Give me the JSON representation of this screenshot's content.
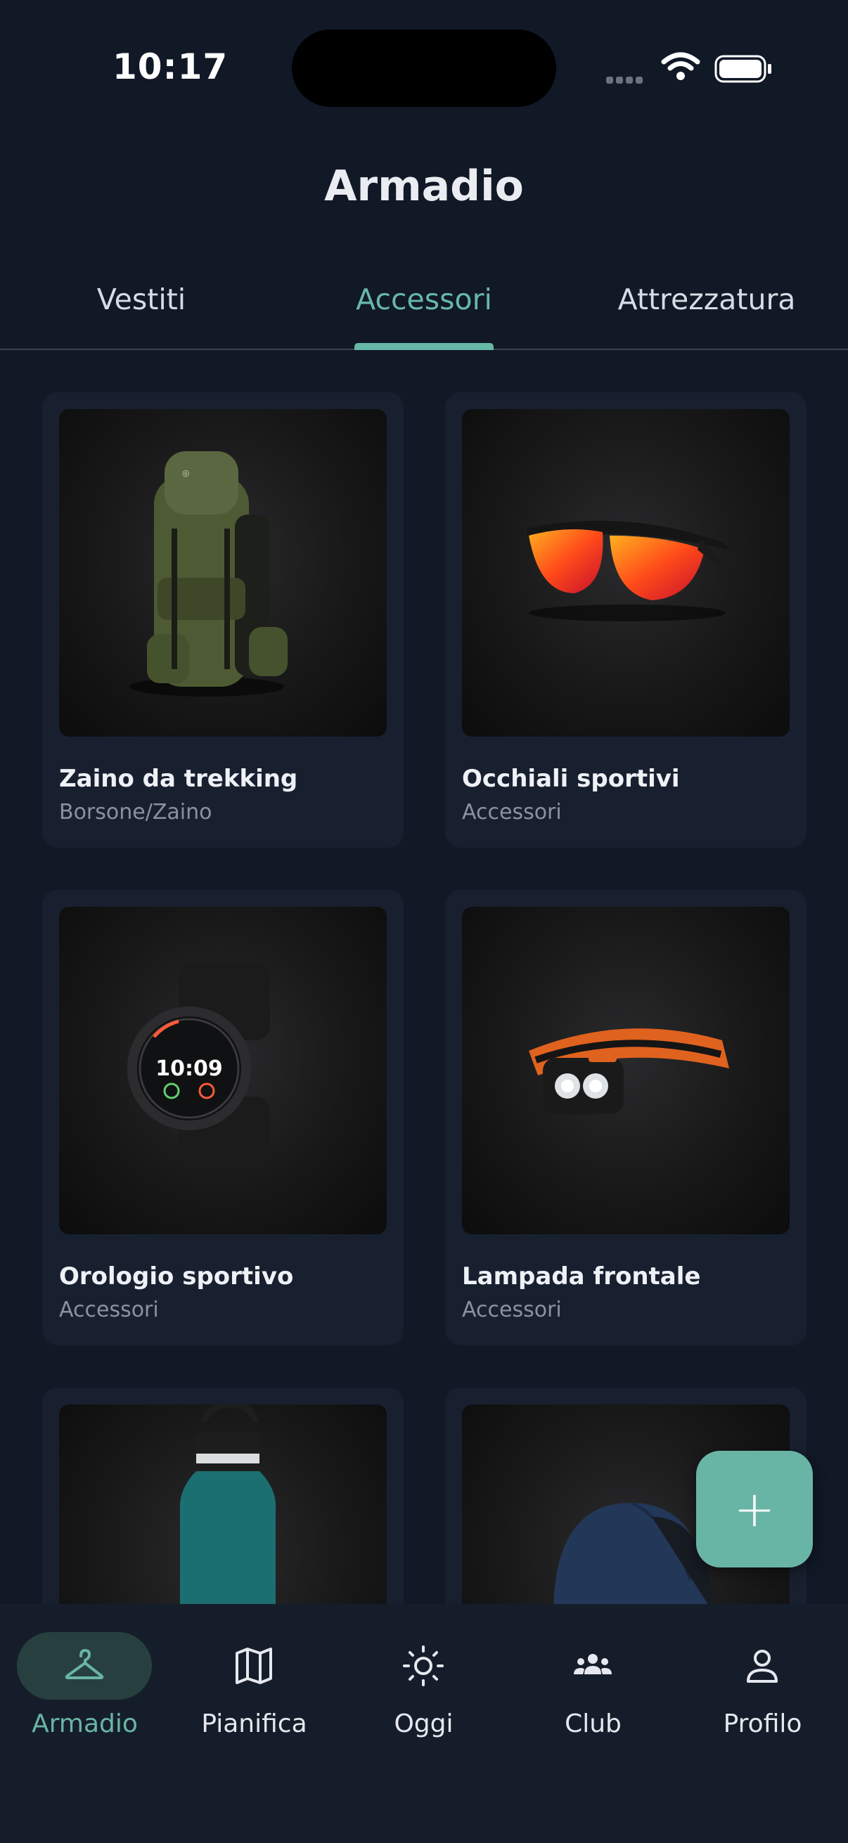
{
  "status_bar": {
    "time": "10:17"
  },
  "header": {
    "title": "Armadio"
  },
  "tabs": [
    {
      "label": "Vestiti"
    },
    {
      "label": "Accessori",
      "active": true
    },
    {
      "label": "Attrezzatura"
    }
  ],
  "items": [
    {
      "name": "Zaino da trekking",
      "category": "Borsone/Zaino",
      "icon": "backpack"
    },
    {
      "name": "Occhiali sportivi",
      "category": "Accessori",
      "icon": "sunglasses"
    },
    {
      "name": "Orologio sportivo",
      "category": "Accessori",
      "icon": "watch",
      "watch_time": "10:09"
    },
    {
      "name": "Lampada frontale",
      "category": "Accessori",
      "icon": "headlamp"
    },
    {
      "name": "",
      "category": "",
      "icon": "water-bottle"
    },
    {
      "name": "",
      "category": "",
      "icon": "cap"
    }
  ],
  "fab": {
    "label": "+"
  },
  "nav": [
    {
      "label": "Armadio",
      "icon": "hanger-icon",
      "active": true
    },
    {
      "label": "Pianifica",
      "icon": "map-icon"
    },
    {
      "label": "Oggi",
      "icon": "sun-icon"
    },
    {
      "label": "Club",
      "icon": "group-icon"
    },
    {
      "label": "Profilo",
      "icon": "user-icon"
    }
  ],
  "colors": {
    "accent": "#69b5a5",
    "background": "#111826",
    "card": "#182030",
    "nav_bg": "#161d2a"
  }
}
